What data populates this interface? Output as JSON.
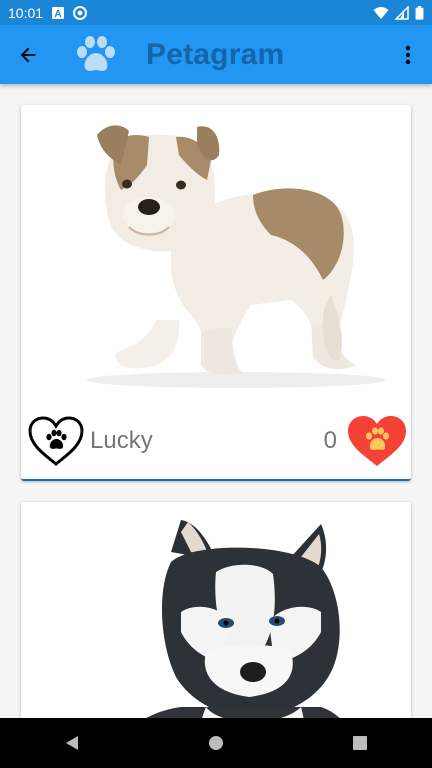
{
  "status_bar": {
    "time": "10:01",
    "icons": [
      "a-notification-icon",
      "sync-icon",
      "wifi-icon",
      "signal-icon",
      "battery-icon"
    ]
  },
  "app_bar": {
    "title": "Petagram",
    "back_icon": "arrow-back-icon",
    "logo_icon": "paw-icon",
    "menu_icon": "more-vert-icon",
    "background_color": "#2196f3",
    "title_color": "#1565a8"
  },
  "pets": [
    {
      "name": "Lucky",
      "likes": "0",
      "breed_image": "bulldog-puppy"
    },
    {
      "breed_image": "husky-puppy"
    }
  ],
  "colors": {
    "accent": "#2196f3",
    "status_bar": "#1b86d8",
    "rating_heart": "#f44336",
    "rating_paw": "#ffc65c"
  },
  "nav_bar": {
    "buttons": [
      "back-triangle-icon",
      "home-circle-icon",
      "recents-square-icon"
    ]
  }
}
